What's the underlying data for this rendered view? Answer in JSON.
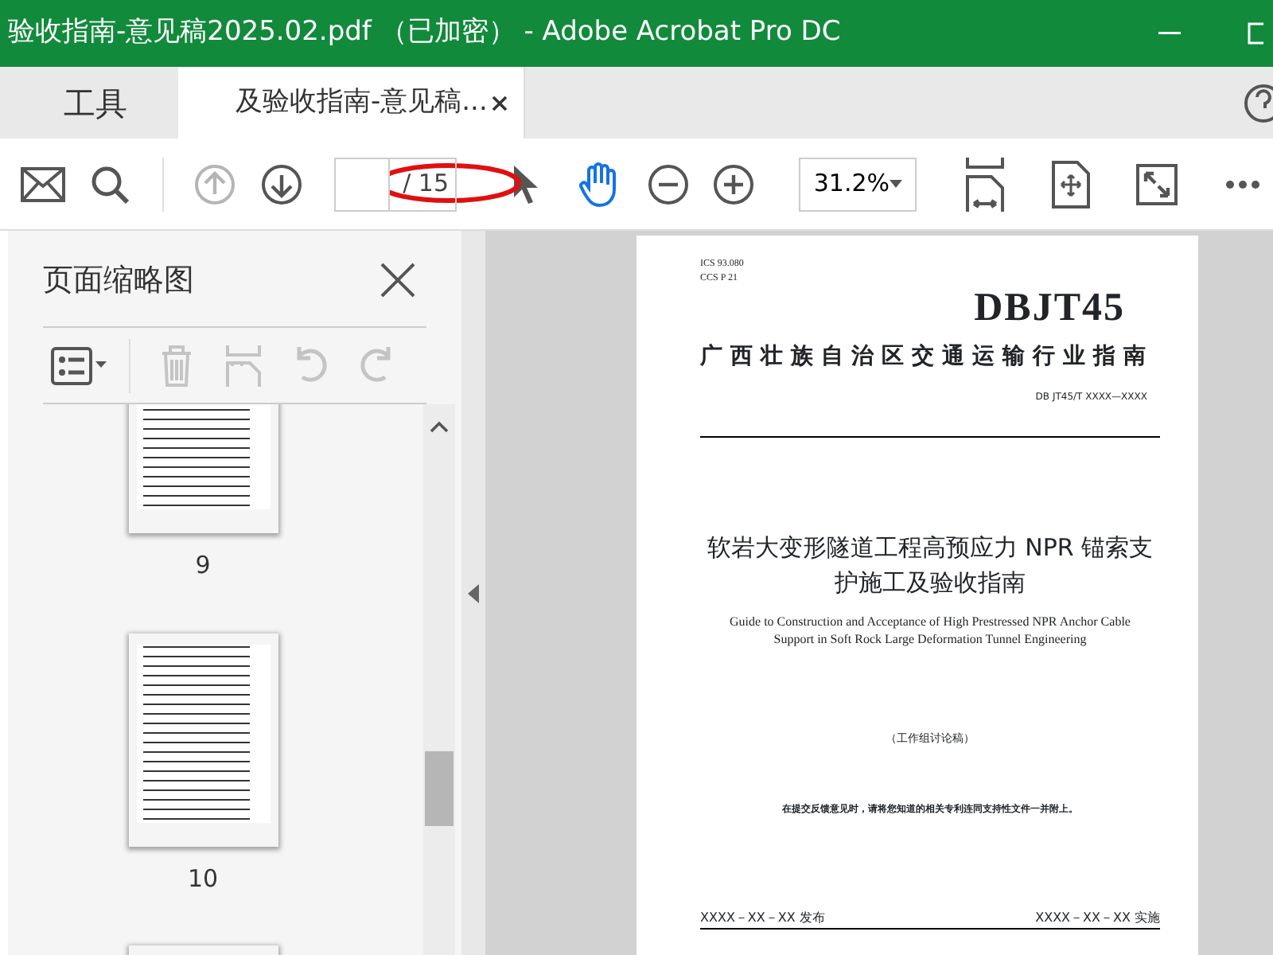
{
  "window": {
    "title": "验收指南-意见稿2025.02.pdf （已加密） - Adobe Acrobat Pro DC"
  },
  "tabs": [
    {
      "label": "工具",
      "selected": false
    },
    {
      "label": "及验收指南-意见稿...",
      "selected": true
    }
  ],
  "toolbar": {
    "page_nav": [
      {
        "kind": "up",
        "disabled": true
      },
      {
        "kind": "down",
        "disabled": false
      }
    ],
    "page_field": {
      "total": "/ 15",
      "circled": true
    },
    "tools": [
      {
        "kind": "select",
        "selected": false
      },
      {
        "kind": "hand",
        "selected": true
      }
    ],
    "zoom": "31.2%"
  },
  "sidebar": {
    "title": "页面缩略图",
    "tools": [
      {
        "kind": "delete",
        "disabled": true
      },
      {
        "kind": "insert",
        "disabled": true
      },
      {
        "kind": "rotate-left",
        "disabled": true
      },
      {
        "kind": "rotate-right",
        "disabled": true
      }
    ],
    "thumbnails": [
      {
        "label": "9"
      },
      {
        "label": "10"
      }
    ]
  },
  "document": {
    "ics": "ICS  93.080",
    "ccs": "CCS  P  21",
    "logo": "DBJT45",
    "org": "广西壮族自治区交通运输行业指南",
    "code": "DB JT45/T  XXXX—XXXX",
    "title": "软岩大变形隧道工程高预应力 NPR 锚索支护施工及验收指南",
    "english": "Guide to Construction and Acceptance of High Prestressed NPR Anchor Cable Support in Soft Rock Large Deformation Tunnel Engineering",
    "draft": "（工作组讨论稿）",
    "notice": "在提交反馈意见时，请将您知道的相关专利连同支持性文件一并附上。",
    "issued": "XXXX－XX－XX 发布",
    "effective": "XXXX－XX－XX 实施"
  }
}
